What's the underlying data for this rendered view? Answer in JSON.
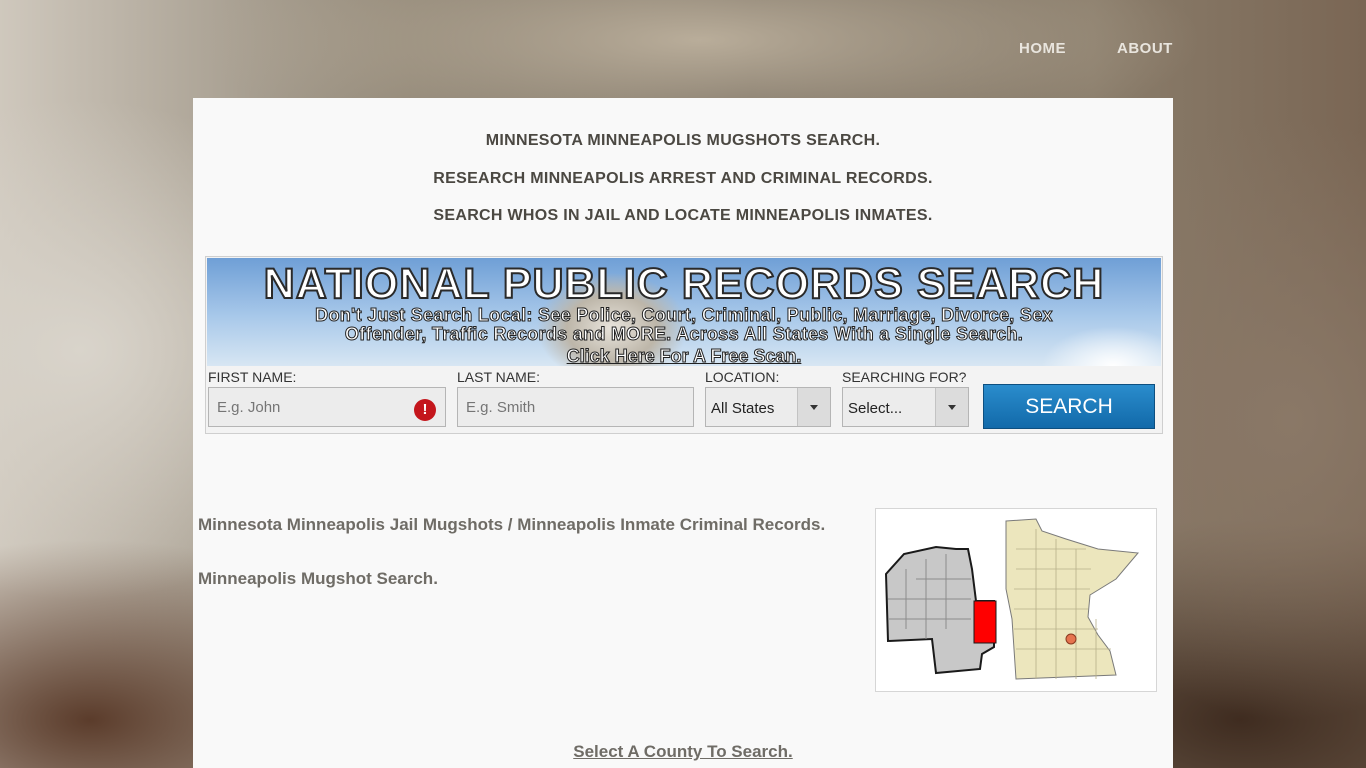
{
  "nav": {
    "home": "HOME",
    "about": "ABOUT"
  },
  "headlines": [
    "MINNESOTA MINNEAPOLIS MUGSHOTS SEARCH.",
    "RESEARCH MINNEAPOLIS ARREST AND CRIMINAL RECORDS.",
    "SEARCH WHOS IN JAIL AND LOCATE MINNEAPOLIS INMATES."
  ],
  "banner": {
    "title": "NATIONAL PUBLIC RECORDS SEARCH",
    "sub1": "Don't Just Search Local: See Police, Court, Criminal, Public, Marriage, Divorce, Sex",
    "sub2": "Offender, Traffic Records and MORE. Across All States With a Single Search.",
    "link": "Click Here For A Free Scan."
  },
  "form": {
    "first_label": "FIRST NAME:",
    "first_placeholder": "E.g. John",
    "last_label": "LAST NAME:",
    "last_placeholder": "E.g. Smith",
    "location_label": "LOCATION:",
    "location_value": "All States",
    "searching_label": "SEARCHING FOR?",
    "searching_value": "Select...",
    "search_button": "SEARCH",
    "error_glyph": "!"
  },
  "content": {
    "line1": "Minnesota Minneapolis Jail Mugshots / Minneapolis Inmate Criminal Records.",
    "line2": "Minneapolis Mugshot Search.",
    "county_link": "Select A County To Search."
  },
  "colors": {
    "accent_button": "#1a7bbd",
    "error": "#c4161c",
    "map_highlight": "#ff0000"
  }
}
